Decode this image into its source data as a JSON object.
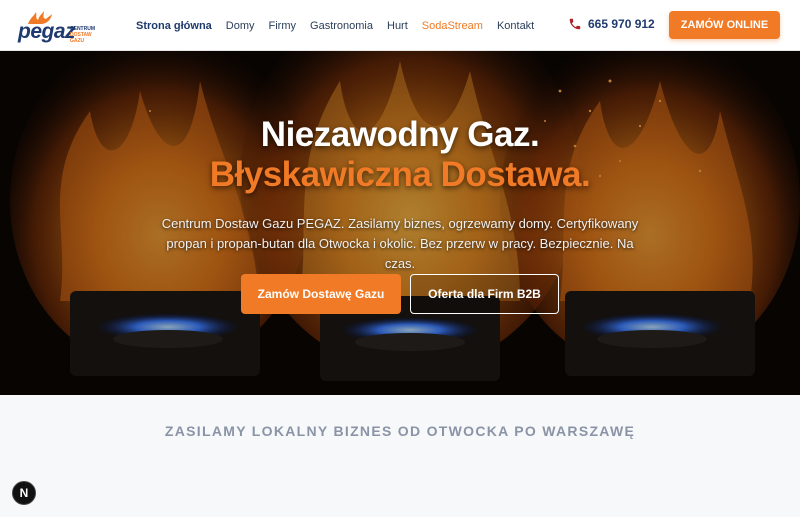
{
  "brand": {
    "logo_text": "pegaz",
    "logo_sub_1": "CENTRUM",
    "logo_sub_2": "DOSTAW GAZU"
  },
  "nav": {
    "items": [
      {
        "label": "Strona główna"
      },
      {
        "label": "Domy"
      },
      {
        "label": "Firmy"
      },
      {
        "label": "Gastronomia"
      },
      {
        "label": "Hurt"
      },
      {
        "label": "SodaStream"
      },
      {
        "label": "Kontakt"
      }
    ],
    "phone": "665 970 912",
    "order_label": "ZAMÓW ONLINE"
  },
  "hero": {
    "title_line1": "Niezawodny Gaz.",
    "title_line2": "Błyskawiczna Dostawa.",
    "description": "Centrum Dostaw Gazu PEGAZ. Zasilamy biznes, ogrzewamy domy. Certyfikowany propan i propan-butan dla Otwocka i okolic. Bez przerw w pracy. Bezpiecznie. Na czas.",
    "primary_button": "Zamów Dostawę Gazu",
    "secondary_button": "Oferta dla Firm B2B"
  },
  "section": {
    "title": "ZASILAMY LOKALNY BIZNES OD OTWOCKA PO WARSZAWĘ"
  },
  "badge": {
    "label": "N"
  },
  "colors": {
    "accent": "#f07a25",
    "navy": "#1f3a6e"
  }
}
